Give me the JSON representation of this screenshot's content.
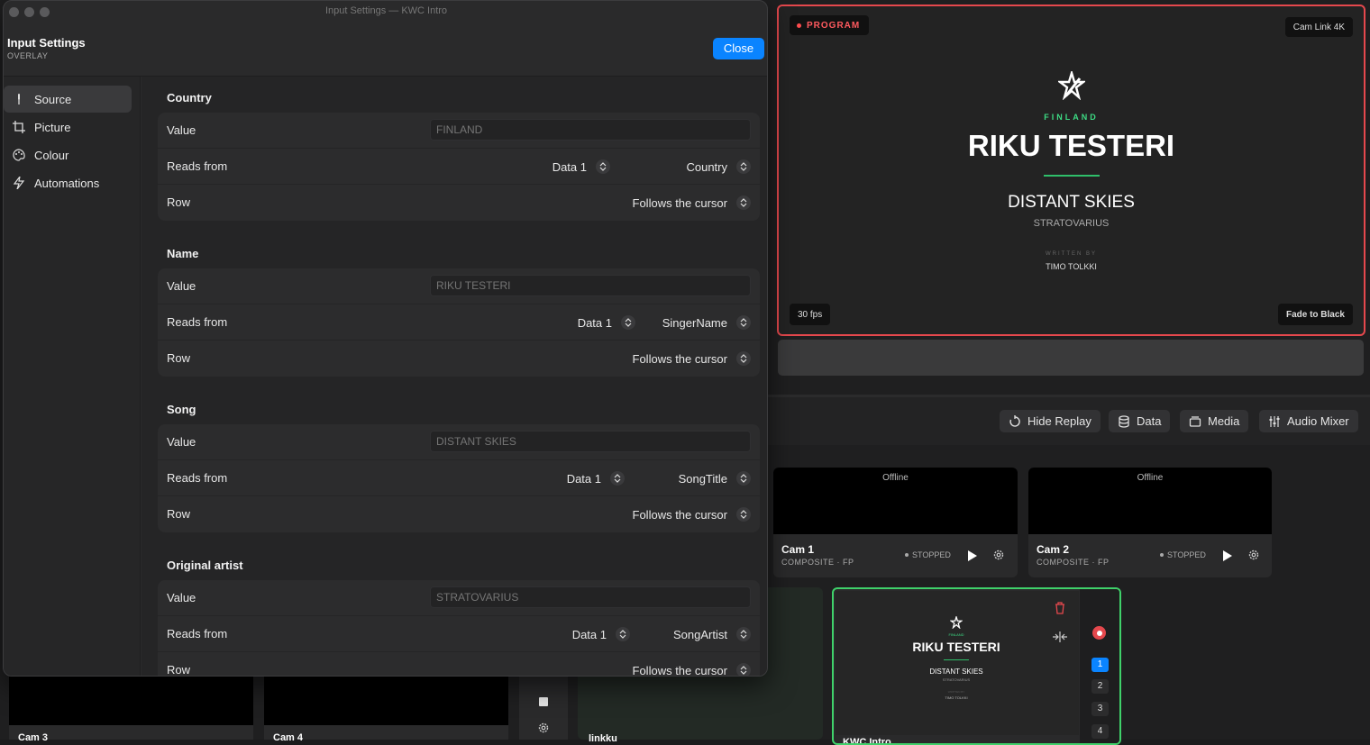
{
  "window": {
    "title": "Input Settings — KWC Intro"
  },
  "header": {
    "title": "Input Settings",
    "subtitle": "OVERLAY",
    "close_label": "Close"
  },
  "sidebar": {
    "items": [
      {
        "label": "Source",
        "icon": "mic-icon",
        "active": true
      },
      {
        "label": "Picture",
        "icon": "crop-icon",
        "active": false
      },
      {
        "label": "Colour",
        "icon": "palette-icon",
        "active": false
      },
      {
        "label": "Automations",
        "icon": "bolt-icon",
        "active": false
      }
    ]
  },
  "row_labels": {
    "value": "Value",
    "reads_from": "Reads from",
    "row": "Row"
  },
  "sections": [
    {
      "title": "Country",
      "value_placeholder": "FINLAND",
      "source": "Data 1",
      "column": "Country",
      "row": "Follows the cursor"
    },
    {
      "title": "Name",
      "value_placeholder": "RIKU TESTERI",
      "source": "Data 1",
      "column": "SingerName",
      "row": "Follows the cursor"
    },
    {
      "title": "Song",
      "value_placeholder": "DISTANT SKIES",
      "source": "Data 1",
      "column": "SongTitle",
      "row": "Follows the cursor"
    },
    {
      "title": "Original artist",
      "value_placeholder": "STRATOVARIUS",
      "source": "Data 1",
      "column": "SongArtist",
      "row": "Follows the cursor"
    }
  ],
  "program": {
    "badge": "PROGRAM",
    "camera": "Cam Link 4K",
    "fps": "30 fps",
    "fade": "Fade to Black",
    "country": "FINLAND",
    "name": "RIKU TESTERI",
    "song": "DISTANT SKIES",
    "artist": "STRATOVARIUS",
    "writer_label": "WRITTEN BY",
    "writer": "TIMO TOLKKI",
    "colors": {
      "live": "#e5484d",
      "accent": "#3ddc84"
    }
  },
  "toolbar": [
    {
      "label": "Hide Replay",
      "icon": "replay-icon"
    },
    {
      "label": "Data",
      "icon": "database-icon"
    },
    {
      "label": "Media",
      "icon": "media-icon"
    },
    {
      "label": "Audio Mixer",
      "icon": "sliders-icon"
    }
  ],
  "cameras": [
    {
      "screen": "Offline",
      "name": "Cam 1",
      "sub": "COMPOSITE · FP",
      "status": "STOPPED"
    },
    {
      "screen": "Offline",
      "name": "Cam 2",
      "sub": "COMPOSITE · FP",
      "status": "STOPPED"
    }
  ],
  "kwc_preview": {
    "country": "FINLAND",
    "name": "RIKU TESTERI",
    "song": "DISTANT SKIES",
    "artist": "STRATOVARIUS",
    "writer_label": "WRITTEN BY",
    "writer": "TIMO TOLKKI",
    "label": "KWC Intro",
    "layers": [
      "1",
      "2",
      "3",
      "4"
    ]
  },
  "lower_labels": {
    "cam3": "Cam 3",
    "cam4": "Cam 4",
    "linkki": "linkku"
  }
}
